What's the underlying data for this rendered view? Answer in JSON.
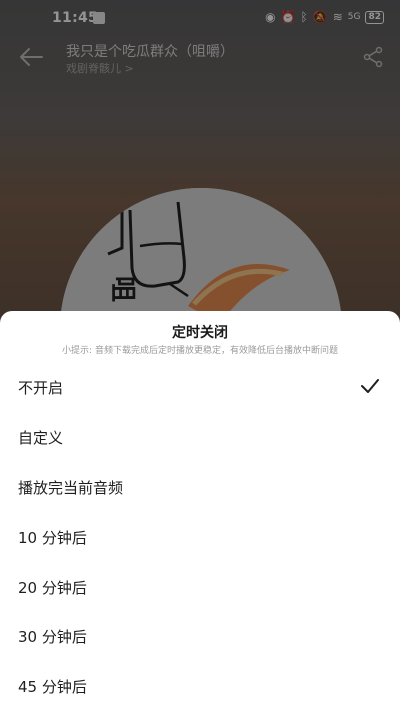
{
  "status_bar": {
    "time": "11:45",
    "battery": "82",
    "signal": "5G"
  },
  "header": {
    "song_title": "我只是个吃瓜群众（咀嚼）",
    "artist": "戏剧脊骸儿 >"
  },
  "sleep_timer": {
    "title": "定时关闭",
    "tip": "小提示: 音频下载完成后定时播放更稳定，有效降低后台播放中断问题",
    "options": [
      {
        "label": "不开启",
        "selected": true
      },
      {
        "label": "自定义",
        "selected": false
      },
      {
        "label": "播放完当前音频",
        "selected": false
      },
      {
        "label": "10 分钟后",
        "selected": false
      },
      {
        "label": "20 分钟后",
        "selected": false
      },
      {
        "label": "30 分钟后",
        "selected": false
      },
      {
        "label": "45 分钟后",
        "selected": false
      }
    ]
  },
  "icons": {
    "back": "back-arrow-icon",
    "share": "share-icon",
    "check": "checkmark-icon"
  },
  "colors": {
    "sheet_bg": "#ffffff",
    "text_primary": "#1f1f1f",
    "text_tip": "#9a9a9a",
    "overlay": "rgba(0,0,0,0.42)"
  }
}
